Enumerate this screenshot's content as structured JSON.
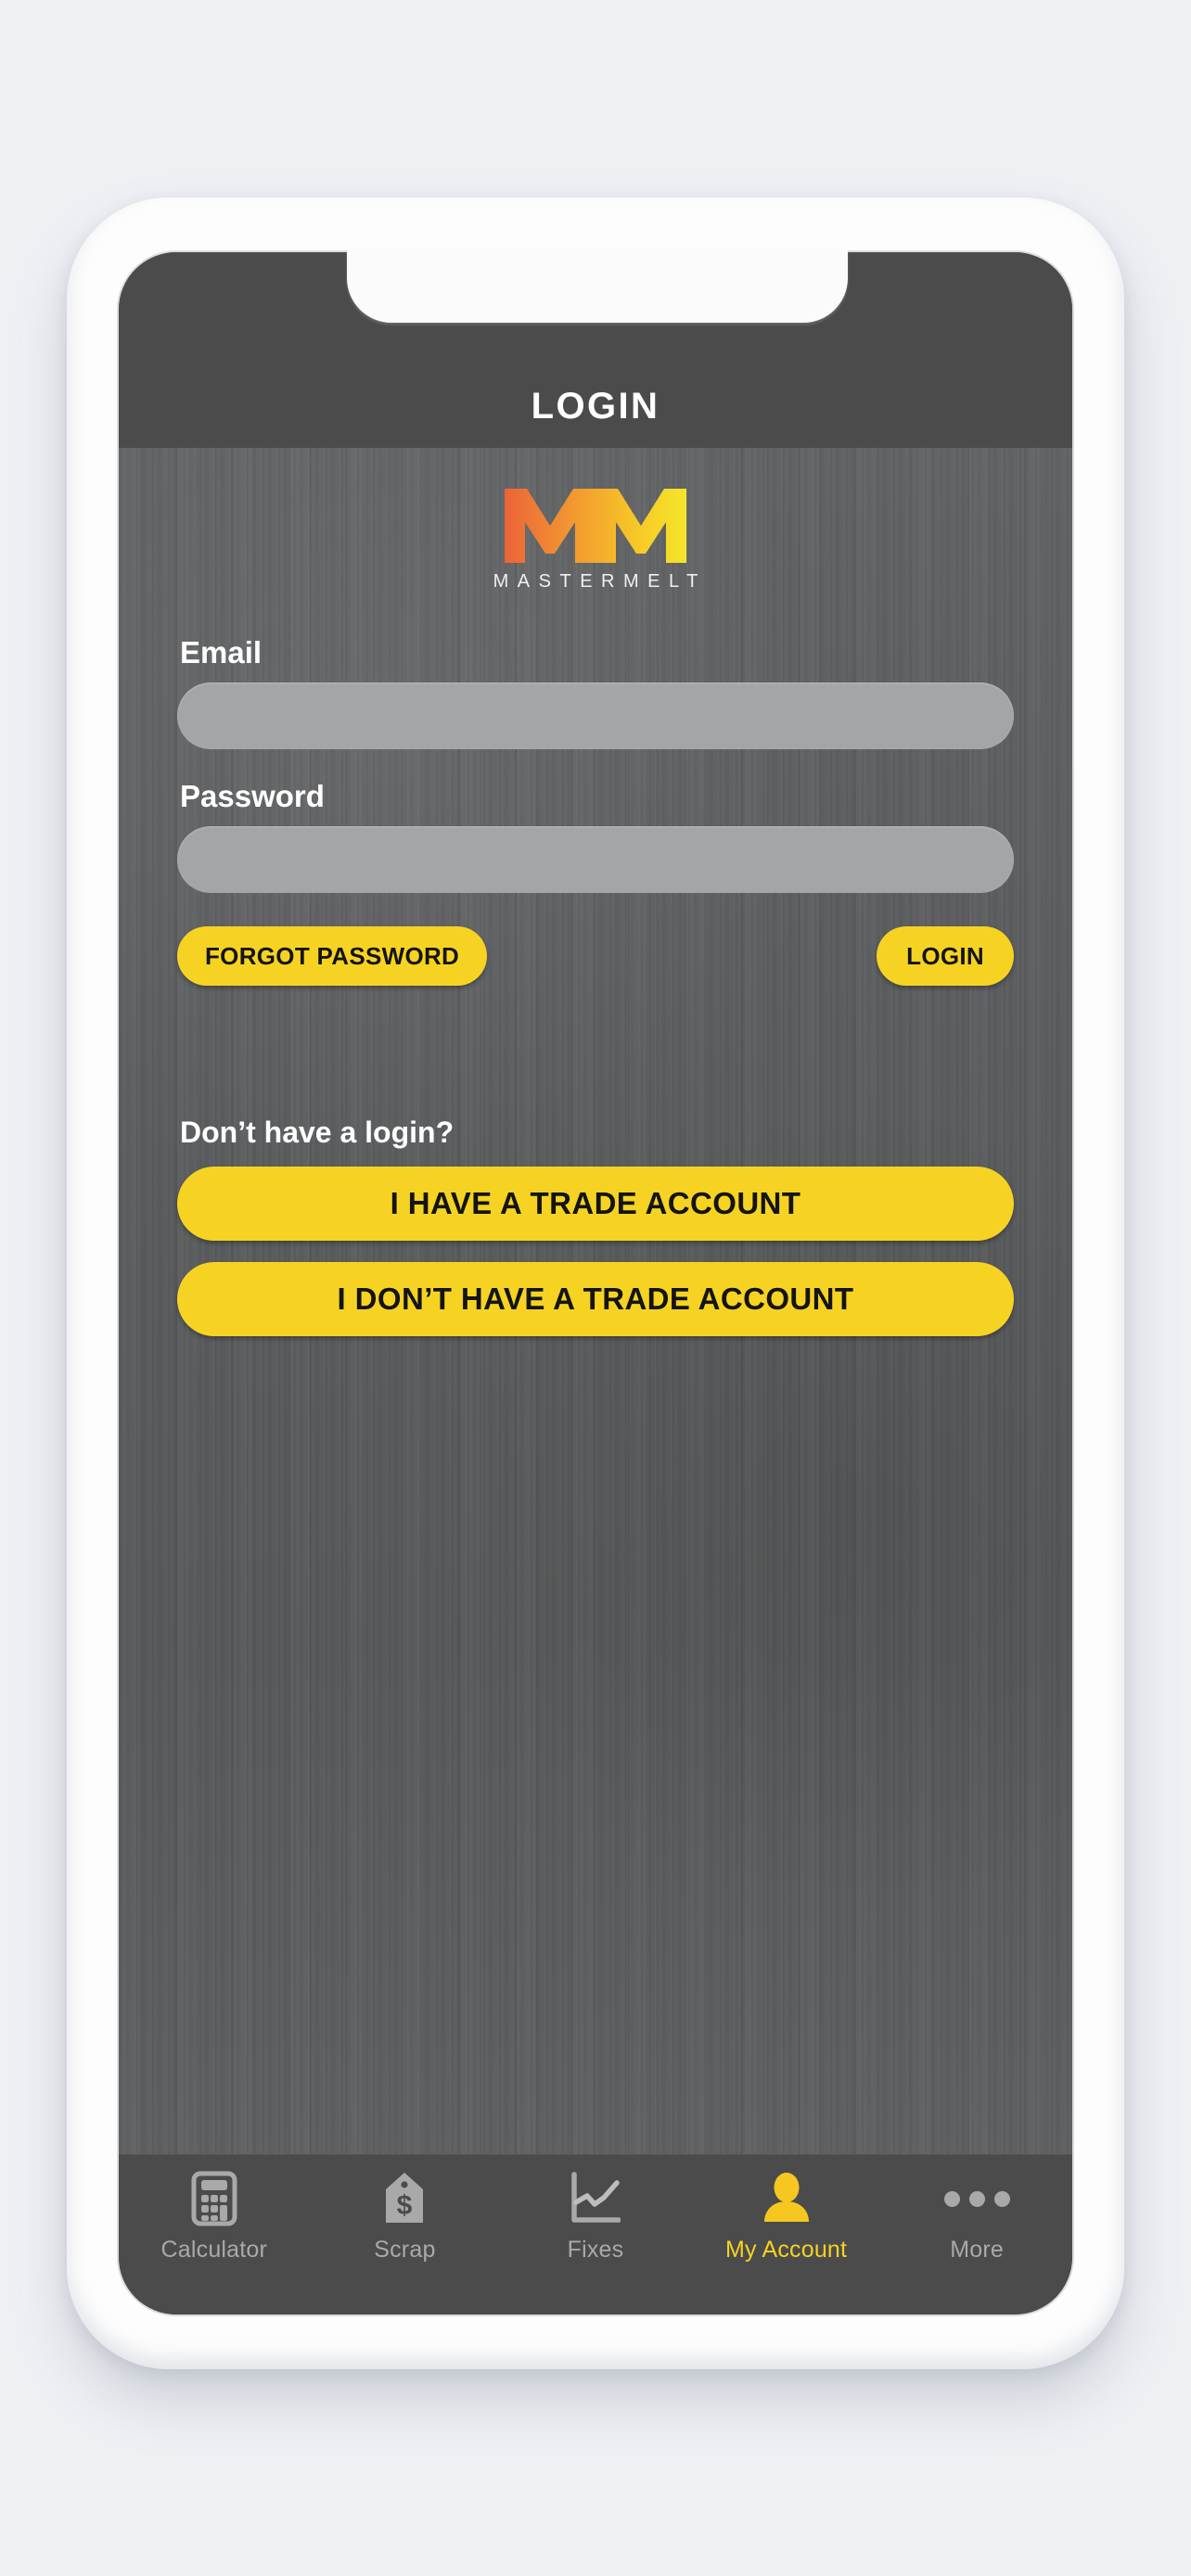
{
  "device": {
    "frame": "iphone-white",
    "notch": true
  },
  "theme": {
    "header_bg": "#4b4b4b",
    "body_bg": "#5a5c5e",
    "accent_yellow": "#f6d323",
    "input_bg": "#a4a5a6",
    "text_light": "#ffffff",
    "tab_inactive": "#a9a9a9"
  },
  "header": {
    "title": "LOGIN"
  },
  "brand": {
    "mark": "mm-monogram",
    "wordmark": "MASTERMELT",
    "gradient_from": "#ec6338",
    "gradient_to": "#f5e52a"
  },
  "form": {
    "email": {
      "label": "Email",
      "value": "",
      "placeholder": ""
    },
    "password": {
      "label": "Password",
      "value": "",
      "placeholder": ""
    },
    "forgot_password_label": "FORGOT PASSWORD",
    "login_label": "LOGIN"
  },
  "signup": {
    "prompt": "Don’t have a login?",
    "have_trade_account_label": "I HAVE A TRADE ACCOUNT",
    "no_trade_account_label": "I DON’T HAVE A TRADE ACCOUNT"
  },
  "tabs": [
    {
      "label": "Calculator",
      "icon": "calculator-icon",
      "active": false
    },
    {
      "label": "Scrap",
      "icon": "price-tag-dollar-icon",
      "active": false
    },
    {
      "label": "Fixes",
      "icon": "line-chart-icon",
      "active": false
    },
    {
      "label": "My Account",
      "icon": "person-icon",
      "active": true
    },
    {
      "label": "More",
      "icon": "ellipsis-icon",
      "active": false
    }
  ]
}
